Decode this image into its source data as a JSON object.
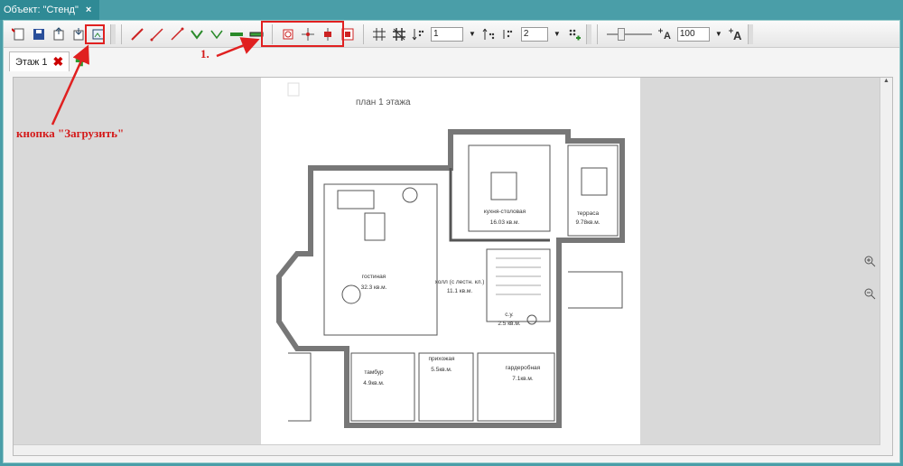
{
  "window": {
    "title": "Объект: \"Стенд\"",
    "close_glyph": "×"
  },
  "toolbar": {
    "line_width_value": "1",
    "line_count_value": "2",
    "zoom_value": "100"
  },
  "tabs": [
    {
      "label": "Этаж 1"
    }
  ],
  "plan": {
    "title": "план 1 этажа",
    "rooms": [
      {
        "name": "гостиная",
        "area": "32.3 кв.м."
      },
      {
        "name": "кухня-столовая",
        "area": "16.03 кв.м."
      },
      {
        "name": "терраса",
        "area": "9.78кв.м."
      },
      {
        "name": "холл (с лестн. кл.)",
        "area": "11.1 кв.м."
      },
      {
        "name": "с.у.",
        "area": "2.5 кв.м."
      },
      {
        "name": "тамбур",
        "area": "4.9кв.м."
      },
      {
        "name": "прихожая",
        "area": "5.5кв.м."
      },
      {
        "name": "гардеробная",
        "area": "7.1кв.м."
      }
    ]
  },
  "annotations": {
    "upload_label": "кнопка \"Загрузить\"",
    "step_label": "1."
  },
  "colors": {
    "frame": "#4a9ea8",
    "annotation": "#e02020"
  }
}
